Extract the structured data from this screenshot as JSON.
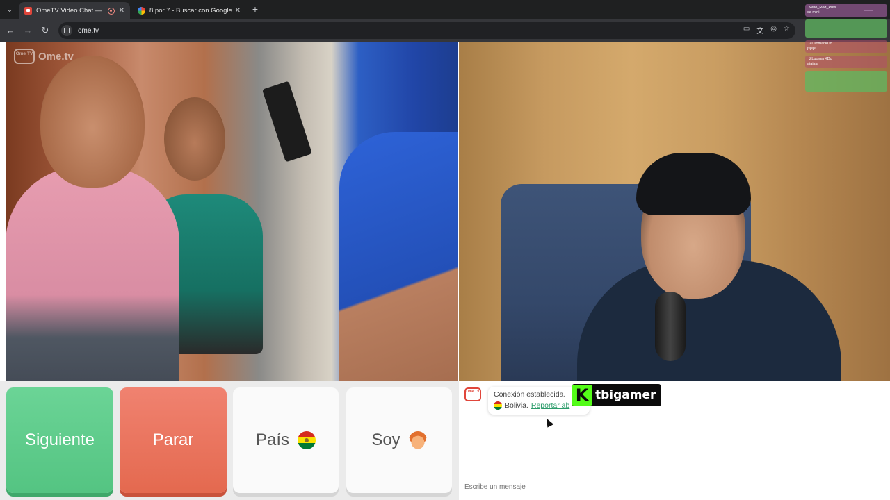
{
  "browser": {
    "tabs": [
      {
        "title": "OmeTV Video Chat — Ome",
        "active": true
      },
      {
        "title": "8 por 7 - Buscar con Google",
        "active": false
      }
    ],
    "url": "ome.tv",
    "tab_close_glyph": "✕",
    "new_tab_glyph": "+",
    "tab_list_glyph": "⌄",
    "nav": {
      "back": "←",
      "forward": "→",
      "reload": "↻"
    },
    "window": {
      "minimize": "—",
      "maximize": "▢"
    },
    "toolbar_icons": [
      "cast-icon",
      "translate-icon",
      "eye-off-icon",
      "star-icon"
    ]
  },
  "brand": {
    "badge": "Ome TV",
    "name": "Ome.tv"
  },
  "overlay_chat": {
    "messages": [
      {
        "name": "Who_Red_Puts",
        "text": "ca mini",
        "color": "#b66bb6"
      },
      {
        "name": "",
        "text": "",
        "color": "#5fb860"
      },
      {
        "name": "ZLuomarXDo",
        "text": "jsjsjs",
        "color": "#b04d6a"
      },
      {
        "name": "ZLuomarXDo",
        "text": "ajajaja",
        "color": "#b04d6a"
      },
      {
        "name": "",
        "text": "",
        "color": "#5fb860"
      }
    ]
  },
  "controls": {
    "next_label": "Siguiente",
    "stop_label": "Parar",
    "country_label": "País",
    "gender_label": "Soy",
    "country_flag": "bolivia-flag-icon",
    "gender_icon": "boy-icon",
    "colors": {
      "next": "#5fcc8c",
      "stop": "#ea735c"
    }
  },
  "chat": {
    "avatar_label": "Ome TV",
    "connection_text": "Conexión establecida.",
    "country": "Bolivia.",
    "report_link": "Reportar ab",
    "input_placeholder": "Escribe un mensaje"
  },
  "streamer_badge": {
    "logo": "K",
    "name": "tbigamer"
  }
}
